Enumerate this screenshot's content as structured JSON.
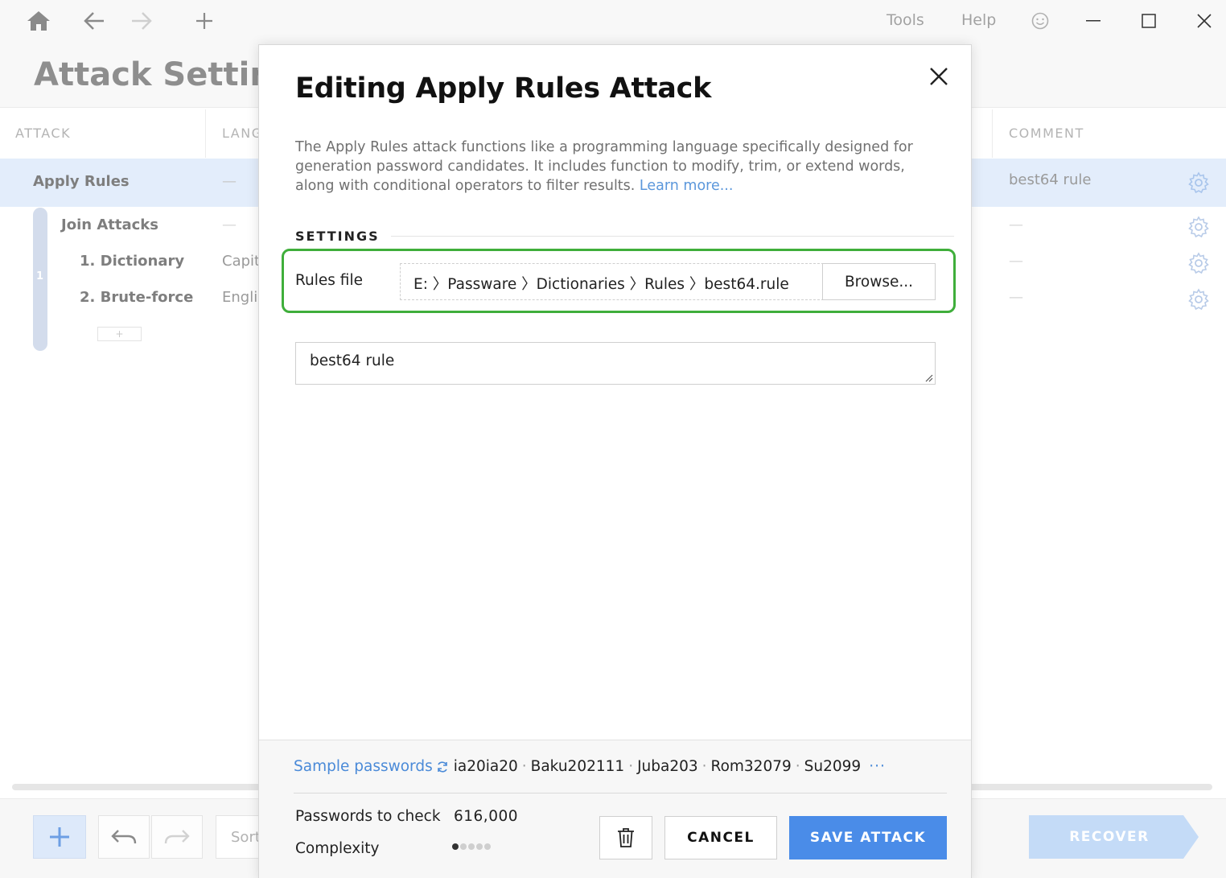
{
  "toolbar": {
    "tools_label": "Tools",
    "help_label": "Help"
  },
  "page": {
    "title": "Attack Settings"
  },
  "table": {
    "columns": [
      "ATTACK",
      "LANG",
      "COMMENT"
    ],
    "rows": [
      {
        "attack": "Apply Rules",
        "language": "—",
        "comment": "best64 rule",
        "selected": true
      },
      {
        "attack": "Join Attacks",
        "language": "—",
        "comment": "—"
      },
      {
        "attack": "1. Dictionary",
        "language": "Capit",
        "comment": "—"
      },
      {
        "attack": "2. Brute-force",
        "language": "Englis",
        "comment": "—"
      }
    ],
    "join_group_number": "1",
    "add_mini_label": "+"
  },
  "bottom": {
    "sort_label": "Sort",
    "recover_label": "RECOVER"
  },
  "dialog": {
    "title": "Editing Apply Rules Attack",
    "description": "The Apply Rules attack functions like a programming language specifically designed for generation password candidates. It includes function to modify, trim, or extend words, along with conditional operators to filter results.",
    "learn_more": "Learn more...",
    "settings_heading": "SETTINGS",
    "rules_file_label": "Rules file",
    "rules_file_path": "E: 〉Passware 〉Dictionaries 〉Rules 〉best64.rule",
    "browse_label": "Browse...",
    "comment_value": "best64 rule",
    "sample_label": "Sample passwords",
    "samples": [
      "ia20ia20",
      "Baku202111",
      "Juba203",
      "Rom32079",
      "Su2099"
    ],
    "more_label": "···",
    "passwords_to_check_label": "Passwords to check",
    "passwords_to_check_value": "616,000",
    "complexity_label": "Complexity",
    "complexity_level": 1,
    "complexity_max": 5,
    "cancel_label": "CANCEL",
    "save_label": "SAVE ATTACK"
  },
  "colors": {
    "accent": "#4a8ce8",
    "highlight": "#3fae3b",
    "selected_row": "#e3edfb",
    "link": "#4a8ad8"
  }
}
